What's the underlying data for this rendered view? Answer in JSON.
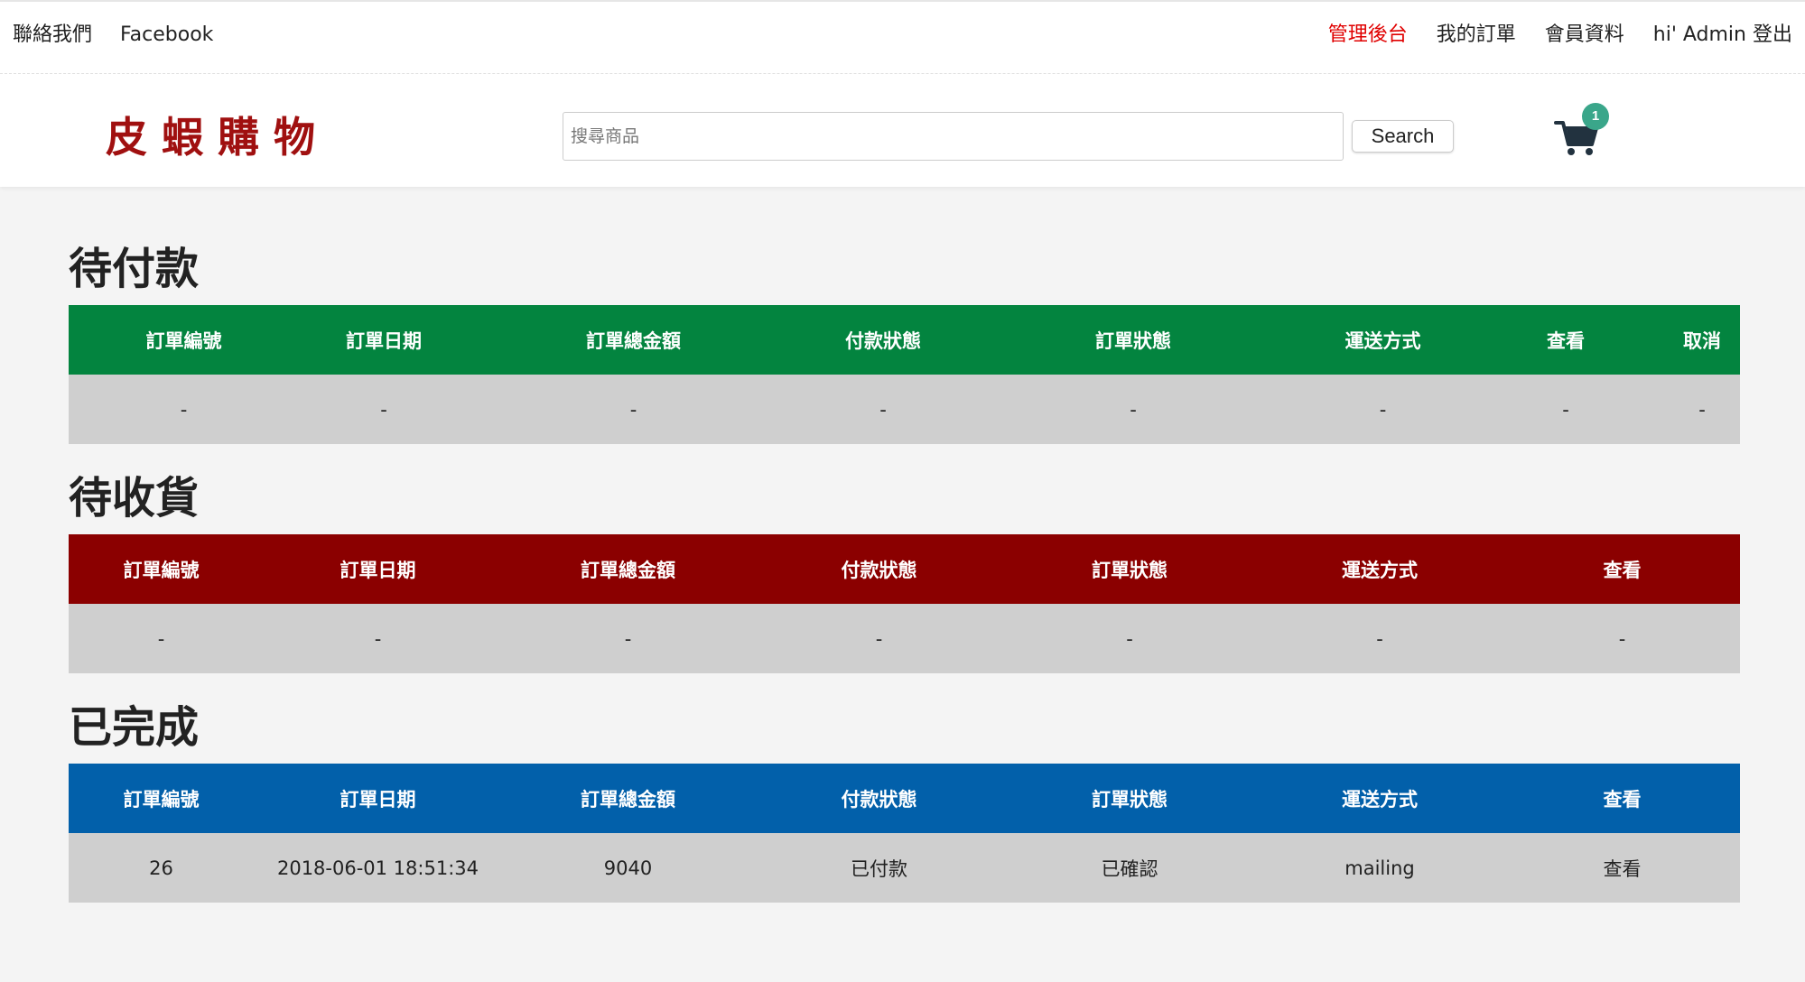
{
  "topbar": {
    "left_links": [
      "聯絡我們",
      "Facebook"
    ],
    "right_links": [
      {
        "label": "管理後台",
        "highlight": true
      },
      {
        "label": "我的訂單",
        "highlight": false
      },
      {
        "label": "會員資料",
        "highlight": false
      },
      {
        "label": "hi' Admin 登出",
        "highlight": false
      }
    ]
  },
  "header": {
    "logo": "皮蝦購物",
    "search_placeholder": "搜尋商品",
    "search_value": "",
    "search_button": "Search",
    "cart_icon": "shopping-cart-icon",
    "cart_count": "1"
  },
  "colors": {
    "pending_header": "#03843f",
    "shipping_header": "#8b0000",
    "completed_header": "#0260aa",
    "admin_link": "#e00000",
    "logo": "#a01010",
    "cart_badge": "#3aa68a"
  },
  "sections": {
    "pending": {
      "title": "待付款",
      "columns": [
        "訂單編號",
        "訂單日期",
        "訂單總金額",
        "付款狀態",
        "訂單狀態",
        "運送方式",
        "查看",
        "取消"
      ],
      "rows": [
        [
          "-",
          "-",
          "-",
          "-",
          "-",
          "-",
          "-",
          "-"
        ]
      ]
    },
    "shipping": {
      "title": "待收貨",
      "columns": [
        "訂單編號",
        "訂單日期",
        "訂單總金額",
        "付款狀態",
        "訂單狀態",
        "運送方式",
        "查看"
      ],
      "rows": [
        [
          "-",
          "-",
          "-",
          "-",
          "-",
          "-",
          "-"
        ]
      ]
    },
    "completed": {
      "title": "已完成",
      "columns": [
        "訂單編號",
        "訂單日期",
        "訂單總金額",
        "付款狀態",
        "訂單狀態",
        "運送方式",
        "查看"
      ],
      "rows": [
        [
          "26",
          "2018-06-01 18:51:34",
          "9040",
          "已付款",
          "已確認",
          "mailing",
          "查看"
        ]
      ]
    }
  }
}
